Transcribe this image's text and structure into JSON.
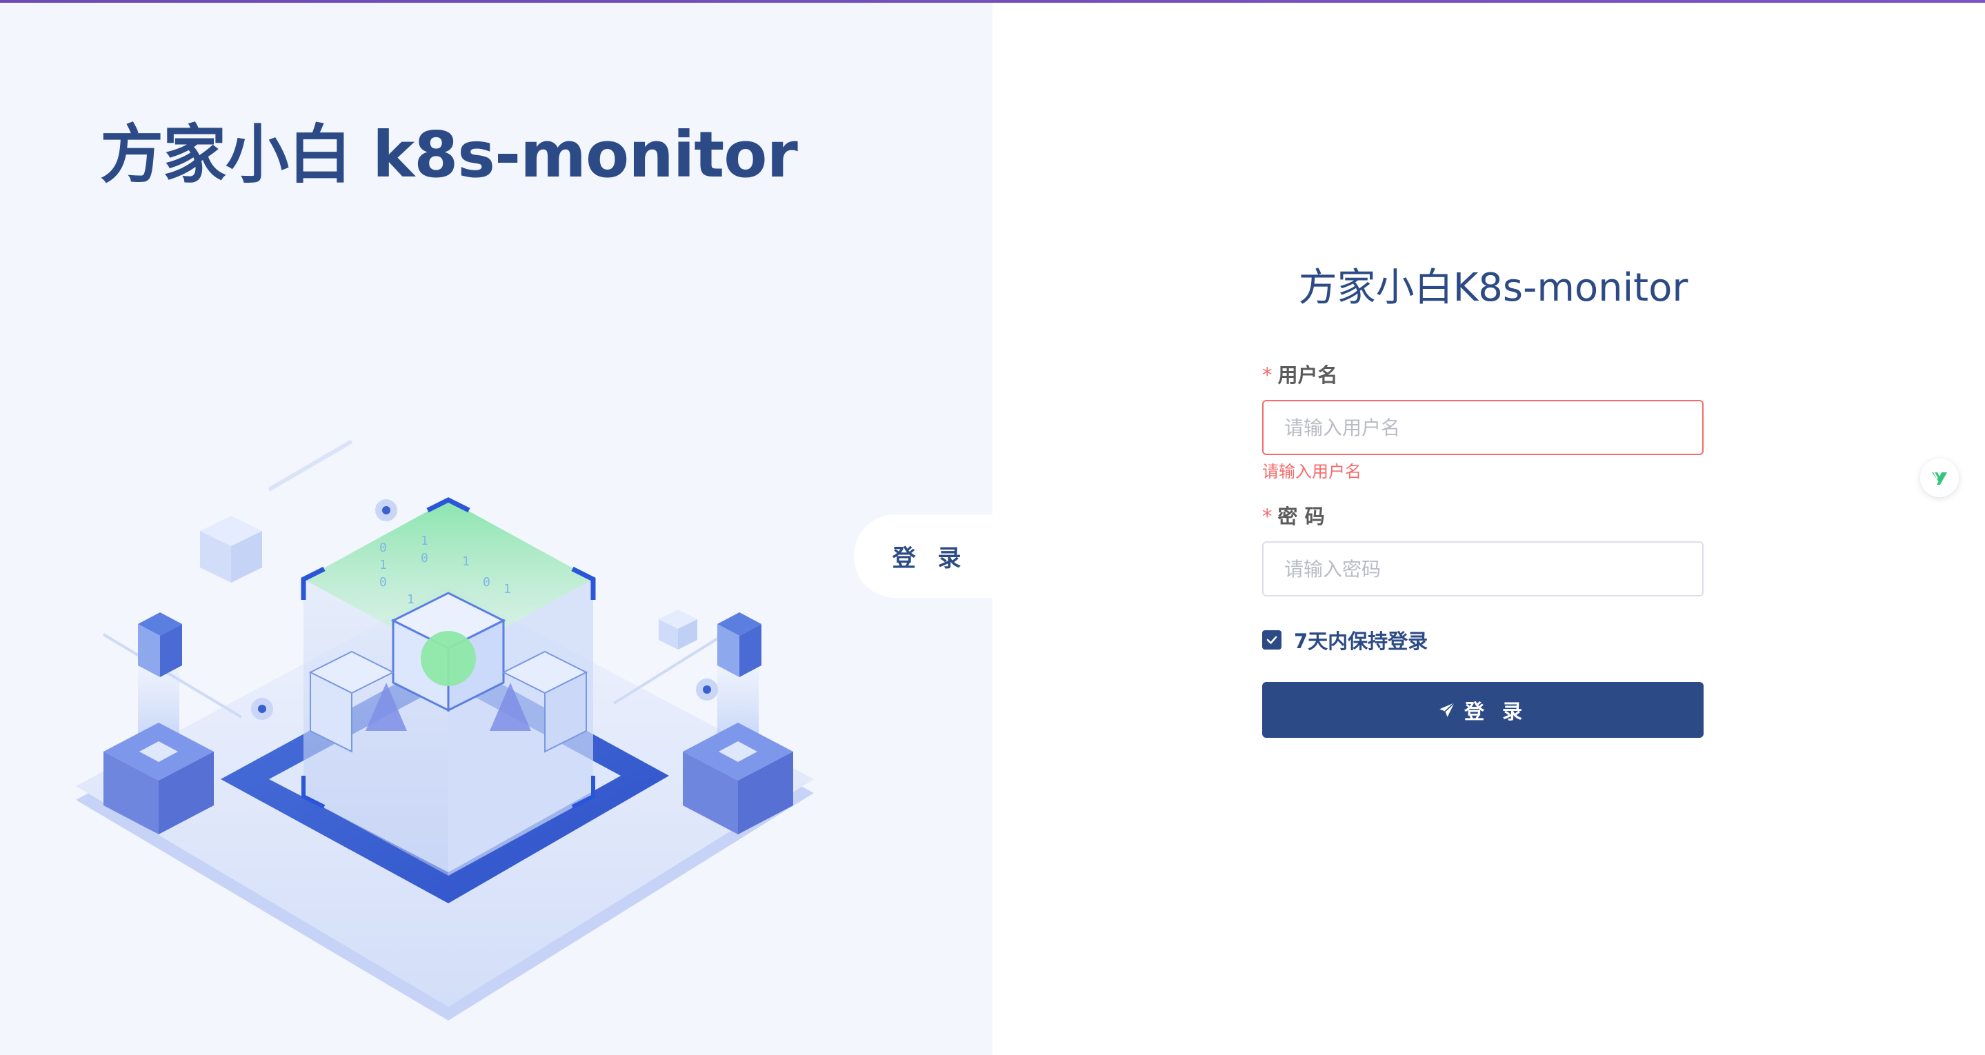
{
  "brand": {
    "title": "方家小白 k8s-monitor"
  },
  "side_tab": {
    "label": "登 录"
  },
  "form": {
    "title": "方家小白K8s-monitor",
    "username": {
      "required_mark": "*",
      "label": "用户名",
      "value": "",
      "placeholder": "请输入用户名",
      "error": "请输入用户名"
    },
    "password": {
      "required_mark": "*",
      "label": "密 码",
      "value": "",
      "placeholder": "请输入密码"
    },
    "remember": {
      "label": "7天内保持登录",
      "checked": true
    },
    "submit_label": "登 录"
  },
  "icons": {
    "submit": "send-icon",
    "side_badge": "assistant-badge-icon",
    "checkbox": "check-icon"
  },
  "colors": {
    "primary": "#2c4a85",
    "error": "#f56c6c",
    "left_background": "#f3f6fc",
    "accent_green": "#34c77b"
  }
}
